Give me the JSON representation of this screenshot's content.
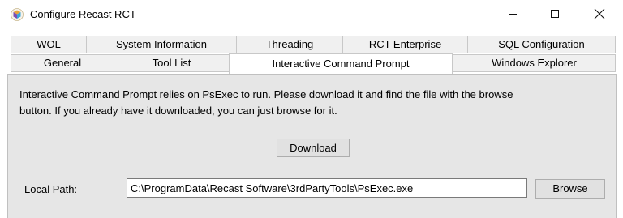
{
  "window": {
    "title": "Configure Recast RCT",
    "controls": {
      "minimize_icon": "minimize-icon",
      "maximize_icon": "maximize-icon",
      "close_icon": "close-icon"
    }
  },
  "tabs": {
    "row1": [
      {
        "label": "WOL"
      },
      {
        "label": "System Information"
      },
      {
        "label": "Threading"
      },
      {
        "label": "RCT Enterprise"
      },
      {
        "label": "SQL Configuration"
      }
    ],
    "row2": [
      {
        "label": "General"
      },
      {
        "label": "Tool List"
      },
      {
        "label": "Interactive Command Prompt",
        "active": true
      },
      {
        "label": "Windows Explorer"
      }
    ]
  },
  "panel": {
    "description_line1": "Interactive Command Prompt relies on PsExec to run. Please download it and find the file with the browse",
    "description_line2": "button. If you already have it downloaded, you can just browse for it.",
    "download_button": "Download",
    "local_path_label": "Local Path:",
    "local_path_value": "C:\\ProgramData\\Recast Software\\3rdPartyTools\\PsExec.exe",
    "browse_button": "Browse"
  },
  "colors": {
    "panel_background": "#e6e6e6",
    "tab_background": "#f0f0f0",
    "button_background": "#e1e1e1"
  }
}
